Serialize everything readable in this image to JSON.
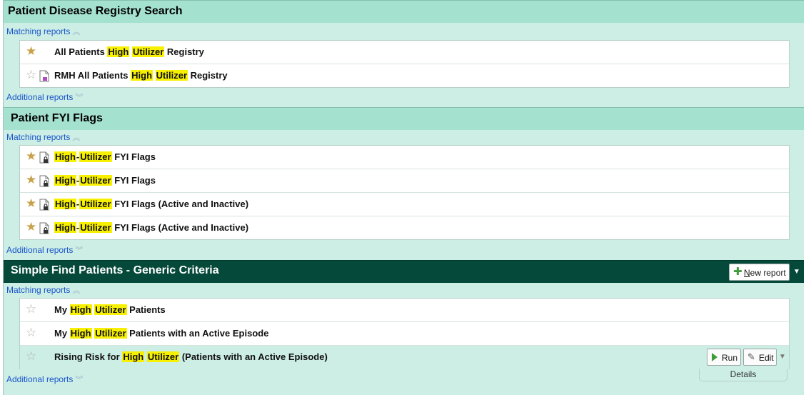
{
  "sections": [
    {
      "title": "Patient Disease Registry Search",
      "matching_label": "Matching reports",
      "additional_label": "Additional reports",
      "reports": [
        {
          "pre": "All Patients ",
          "hl1": "High",
          "sp": " ",
          "hl2": "Utilizer",
          "post": " Registry"
        },
        {
          "pre": "RMH All Patients ",
          "hl1": "High",
          "sp": " ",
          "hl2": "Utilizer",
          "post": " Registry"
        }
      ]
    },
    {
      "title": "Patient FYI Flags",
      "matching_label": "Matching reports",
      "additional_label": "Additional reports",
      "reports": [
        {
          "pre": "",
          "hl1": "High",
          "sp": "-",
          "hl2": "Utilizer",
          "post": " FYI Flags"
        },
        {
          "pre": "",
          "hl1": "High",
          "sp": "-",
          "hl2": "Utilizer",
          "post": " FYI Flags"
        },
        {
          "pre": "",
          "hl1": "High",
          "sp": "-",
          "hl2": "Utilizer",
          "post": " FYI Flags (Active and Inactive)"
        },
        {
          "pre": "",
          "hl1": "High",
          "sp": "-",
          "hl2": "Utilizer",
          "post": " FYI Flags (Active and Inactive)"
        }
      ]
    },
    {
      "title": "Simple Find Patients - Generic Criteria",
      "matching_label": "Matching reports",
      "additional_label": "Additional reports",
      "new_report_prefix": "N",
      "new_report_rest": "ew report",
      "reports": [
        {
          "pre": "My ",
          "hl1": "High",
          "sp": " ",
          "hl2": "Utilizer",
          "post": " Patients"
        },
        {
          "pre": "My ",
          "hl1": "High",
          "sp": " ",
          "hl2": "Utilizer",
          "post": " Patients with an Active Episode"
        },
        {
          "pre": "Rising Risk for ",
          "hl1": "High",
          "sp": " ",
          "hl2": "Utilizer",
          "post": " (Patients with an Active Episode)"
        }
      ],
      "run_label": "Run",
      "edit_label": "Edit",
      "details_label": "Details"
    }
  ],
  "icons": {
    "star": "star-icon",
    "report": "report-document-icon",
    "locked_report": "locked-report-icon",
    "collapse": "chevron-up-icon",
    "expand": "chevron-down-icon",
    "add": "plus-icon",
    "run": "play-icon",
    "edit": "pencil-icon"
  },
  "colors": {
    "section_header": "#a5e1cf",
    "active_section_header": "#05493a",
    "panel_background": "#cdeee4",
    "link": "#1a55cc",
    "search_highlight": "#f7f000",
    "favorite_star": "#c9a14a"
  }
}
